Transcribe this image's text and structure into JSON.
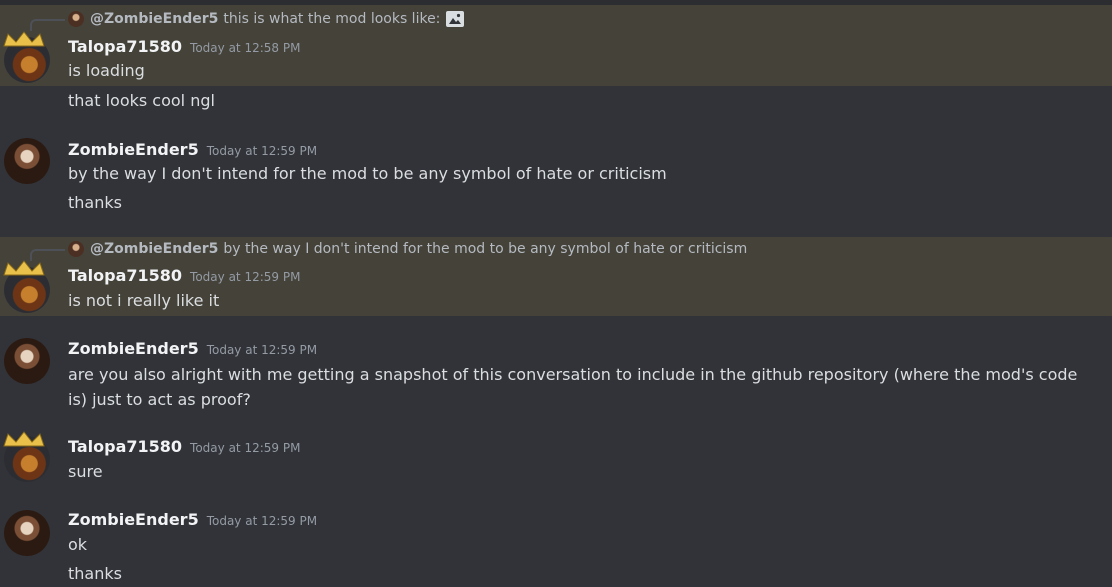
{
  "messages": [
    {
      "reply": {
        "name": "@ZombieEnder5",
        "text": "this is what the mod looks like:",
        "icon": "image-icon"
      },
      "author": "Talopa71580",
      "timestamp": "Today at 12:58 PM",
      "lines": [
        "is loading",
        "that looks cool ngl"
      ]
    },
    {
      "author": "ZombieEnder5",
      "timestamp": "Today at 12:59 PM",
      "lines": [
        "by the way I don't intend for the mod to be any symbol of hate or criticism",
        "thanks"
      ]
    },
    {
      "reply": {
        "name": "@ZombieEnder5",
        "text": "by the way I don't intend for the mod to be any symbol of hate or criticism"
      },
      "author": "Talopa71580",
      "timestamp": "Today at 12:59 PM",
      "lines": [
        "is not i really like it"
      ]
    },
    {
      "author": "ZombieEnder5",
      "timestamp": "Today at 12:59 PM",
      "lines": [
        "are you also alright with me getting a snapshot of this conversation to include in the github repository (where the mod's code is) just to act as proof?"
      ]
    },
    {
      "author": "Talopa71580",
      "timestamp": "Today at 12:59 PM",
      "lines": [
        "sure"
      ]
    },
    {
      "author": "ZombieEnder5",
      "timestamp": "Today at 12:59 PM",
      "lines": [
        "ok",
        "thanks"
      ]
    }
  ],
  "colors": {
    "background": "#313338",
    "highlight": "#444239",
    "username": "#f2f3f5",
    "text": "#dbdee1",
    "muted": "#949ba4"
  }
}
